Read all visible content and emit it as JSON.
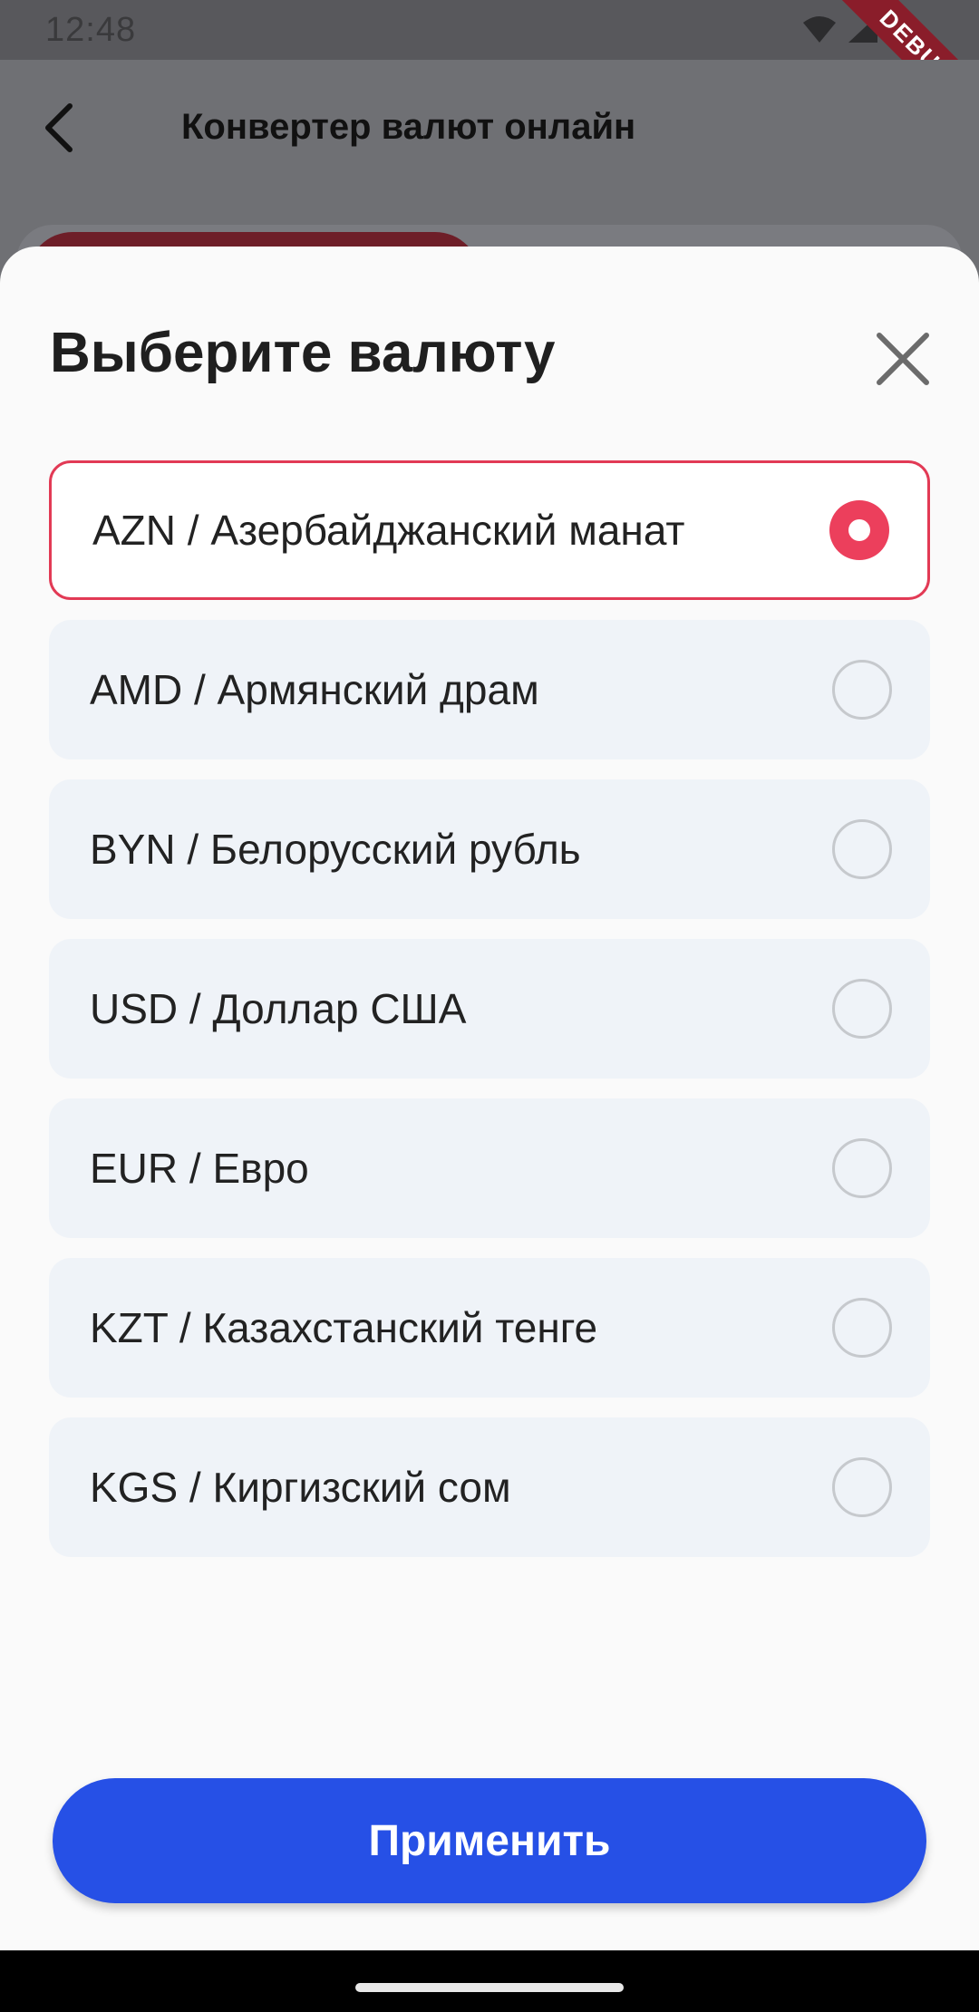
{
  "status_bar": {
    "time": "12:48",
    "debug_label": "DEBUG",
    "icons": [
      "wifi-icon",
      "signal-icon",
      "battery-icon"
    ]
  },
  "app_bar": {
    "title": "Конвертер валют онлайн",
    "back_icon": "chevron-left-icon"
  },
  "sheet": {
    "title": "Выберите валюту",
    "close_icon": "close-icon",
    "options": [
      {
        "label": "AZN / Азербайджанский манат",
        "selected": true
      },
      {
        "label": "AMD / Армянский драм",
        "selected": false
      },
      {
        "label": "BYN / Белорусский рубль",
        "selected": false
      },
      {
        "label": "USD / Доллар США",
        "selected": false
      },
      {
        "label": "EUR / Евро",
        "selected": false
      },
      {
        "label": "KZT / Казахстанский тенге",
        "selected": false
      },
      {
        "label": "KGS / Киргизский сом",
        "selected": false
      }
    ],
    "apply_label": "Применить"
  },
  "colors": {
    "accent": "#ec3f5c",
    "primary_button": "#2650e6",
    "option_background": "#eff3f8"
  }
}
